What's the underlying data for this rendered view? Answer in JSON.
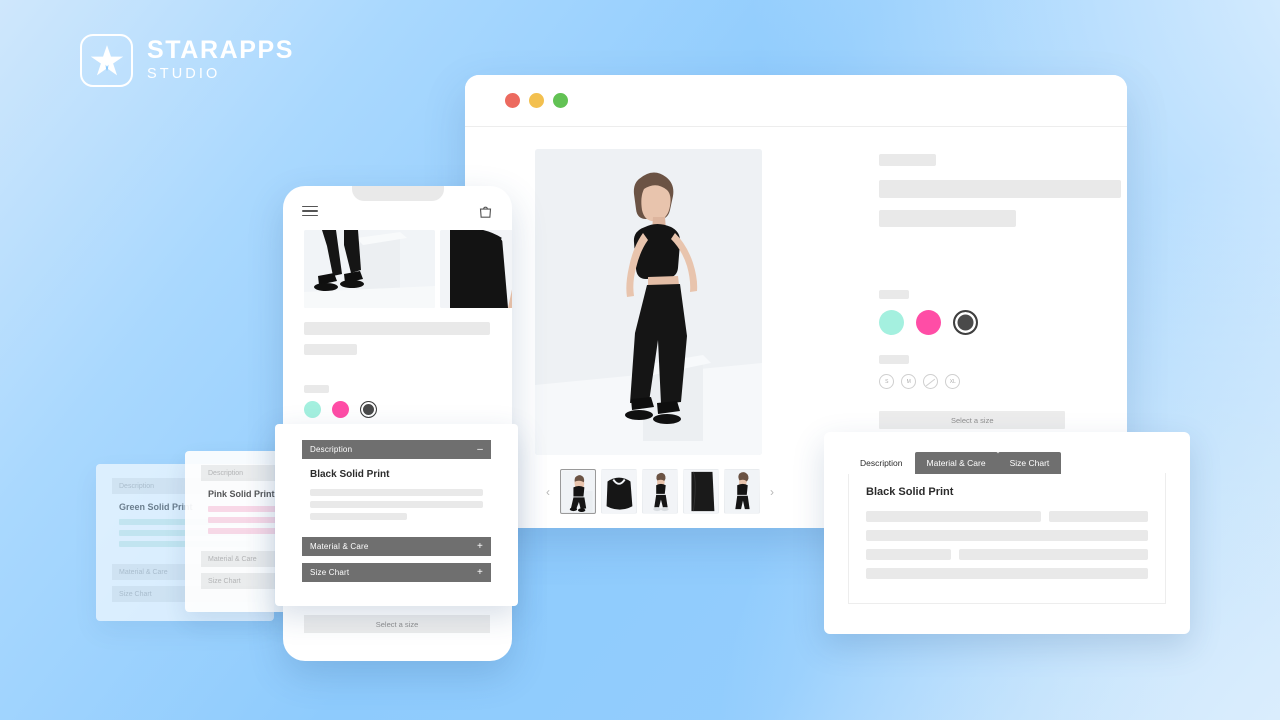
{
  "brand": {
    "name": "STARAPPS",
    "tagline": "STUDIO",
    "icon": "star-icon",
    "color": "#ffffff"
  },
  "background": {
    "gradient_from": "#cfe7fc",
    "gradient_to": "#8ecbfd"
  },
  "desktop_window": {
    "traffic_lights": [
      {
        "name": "close",
        "color": "#ec6a5f"
      },
      {
        "name": "minimize",
        "color": "#f3c04f"
      },
      {
        "name": "maximize",
        "color": "#62c254"
      }
    ],
    "gallery": {
      "thumbnails": [
        {
          "label": "full-look",
          "selected": true
        },
        {
          "label": "crop-top-detail",
          "selected": false
        },
        {
          "label": "side-view",
          "selected": false
        },
        {
          "label": "fabric-detail",
          "selected": false
        },
        {
          "label": "back-view",
          "selected": false
        }
      ],
      "prev_arrow": "‹",
      "next_arrow": "›"
    },
    "color_option": {
      "swatches": [
        {
          "name": "mint",
          "color": "#a4f0df",
          "selected": false
        },
        {
          "name": "pink",
          "color": "#ff4da6",
          "selected": false
        },
        {
          "name": "black",
          "color": "#4a4a4a",
          "selected": true
        }
      ]
    },
    "size_option": {
      "sizes": [
        {
          "label": "S",
          "available": true
        },
        {
          "label": "M",
          "available": true
        },
        {
          "label": "L",
          "available": false
        },
        {
          "label": "XL",
          "available": true
        }
      ]
    },
    "cta": "Select a size"
  },
  "mobile_window": {
    "menu_icon": "hamburger-icon",
    "bag_icon": "shopping-bag-icon",
    "color_option": {
      "swatches": [
        {
          "name": "mint",
          "color": "#a4f0df",
          "selected": false
        },
        {
          "name": "pink",
          "color": "#ff4da6",
          "selected": false
        },
        {
          "name": "black",
          "color": "#4a4a4a",
          "selected": true
        }
      ]
    },
    "cta": "Select a size"
  },
  "accordion_card": {
    "sections": [
      {
        "label": "Description",
        "sign": "–",
        "expanded": true
      },
      {
        "label": "Material & Care",
        "sign": "+",
        "expanded": false
      },
      {
        "label": "Size Chart",
        "sign": "+",
        "expanded": false
      }
    ],
    "content_title": "Black Solid Print",
    "header_bg": "#6f6f6f"
  },
  "tab_card": {
    "tabs": [
      {
        "label": "Description",
        "active": true
      },
      {
        "label": "Material & Care",
        "active": false
      },
      {
        "label": "Size Chart",
        "active": false
      }
    ],
    "content_title": "Black Solid Print"
  },
  "ghost_cards": [
    {
      "id": "green",
      "content_title": "Green Solid Print",
      "accent": "#d6efe8",
      "sections": [
        {
          "label": "Description"
        },
        {
          "label": "Material & Care"
        },
        {
          "label": "Size Chart"
        }
      ]
    },
    {
      "id": "pink",
      "content_title": "Pink Solid Print",
      "accent": "#fbd7e6",
      "sections": [
        {
          "label": "Description"
        },
        {
          "label": "Material & Care"
        },
        {
          "label": "Size Chart"
        }
      ]
    }
  ]
}
